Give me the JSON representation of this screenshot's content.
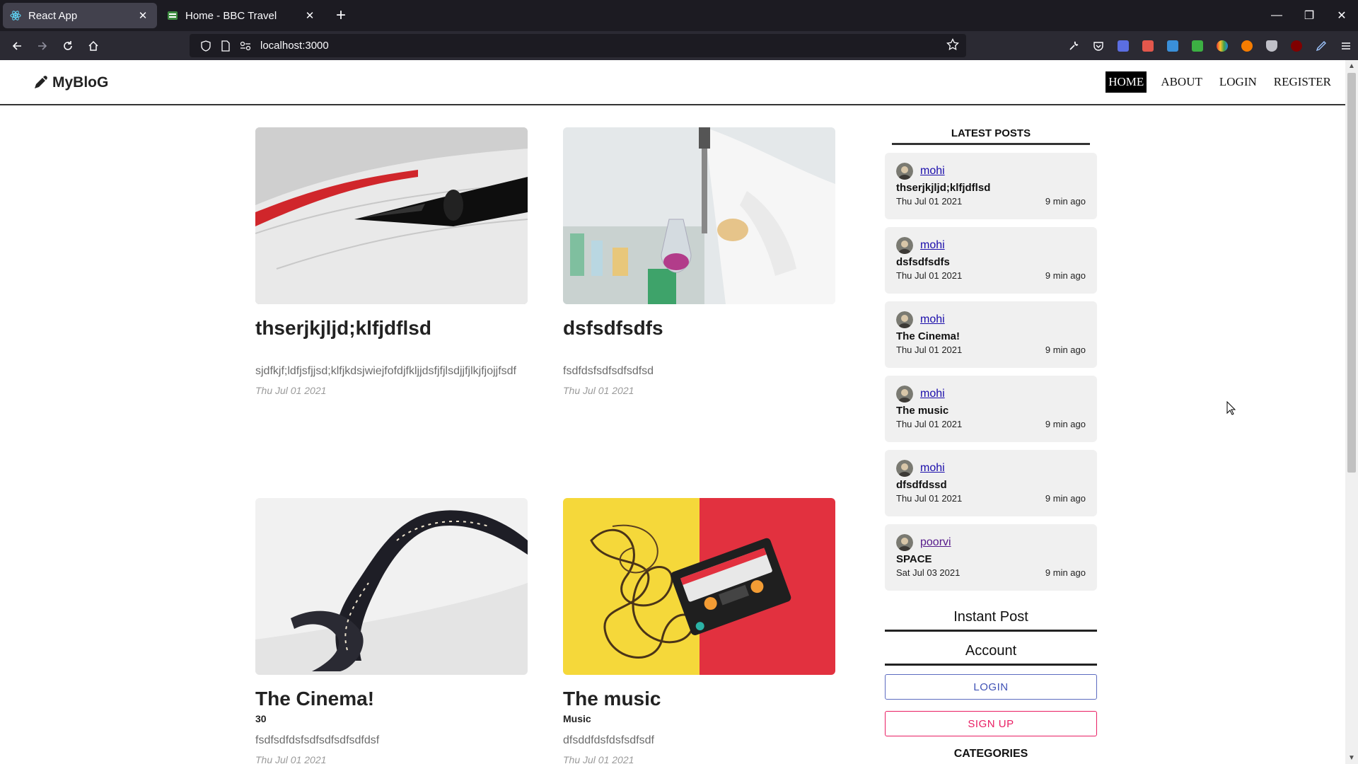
{
  "browser": {
    "tabs": [
      {
        "label": "React App",
        "active": true,
        "icon": "react-icon"
      },
      {
        "label": "Home - BBC Travel",
        "active": false,
        "icon": "bbc-icon"
      }
    ],
    "url": "localhost:3000"
  },
  "site": {
    "logo": "MyBloG",
    "menu": [
      "HOME",
      "ABOUT",
      "LOGIN",
      "REGISTER"
    ]
  },
  "posts": [
    {
      "title": "thserjkjljd;klfjdflsd",
      "category": "",
      "desc": "sjdfkjf;ldfjsfjjsd;klfjkdsjwiejfofdjfkljjdsfjfjlsdjjfjlkjfjojjfsdf",
      "date": "Thu Jul 01 2021"
    },
    {
      "title": "dsfsdfsdfs",
      "category": "",
      "desc": "fsdfdsfsdfsdfsdfsd",
      "date": "Thu Jul 01 2021"
    },
    {
      "title": "The Cinema!",
      "category": "30",
      "desc": "fsdfsdfdsfsdfsdfsdfsdfdsf",
      "date": "Thu Jul 01 2021"
    },
    {
      "title": "The music",
      "category": "Music",
      "desc": "dfsddfdsfdsfsdfsdf",
      "date": "Thu Jul 01 2021"
    }
  ],
  "sidebar": {
    "latest_heading": "LATEST POSTS",
    "latest": [
      {
        "author": "mohi",
        "title": "thserjkjljd;klfjdflsd",
        "date": "Thu Jul 01 2021",
        "ago": "9 min ago"
      },
      {
        "author": "mohi",
        "title": "dsfsdfsdfs",
        "date": "Thu Jul 01 2021",
        "ago": "9 min ago"
      },
      {
        "author": "mohi",
        "title": "The Cinema!",
        "date": "Thu Jul 01 2021",
        "ago": "9 min ago"
      },
      {
        "author": "mohi",
        "title": "The music",
        "date": "Thu Jul 01 2021",
        "ago": "9 min ago"
      },
      {
        "author": "mohi",
        "title": "dfsdfdssd",
        "date": "Thu Jul 01 2021",
        "ago": "9 min ago"
      },
      {
        "author": "poorvi",
        "title": "SPACE",
        "date": "Sat Jul 03 2021",
        "ago": "9 min ago"
      }
    ],
    "instant_post": "Instant Post",
    "account": "Account",
    "login_btn": "LOGIN",
    "signup_btn": "SIGN UP",
    "categories": "CATEGORIES"
  }
}
